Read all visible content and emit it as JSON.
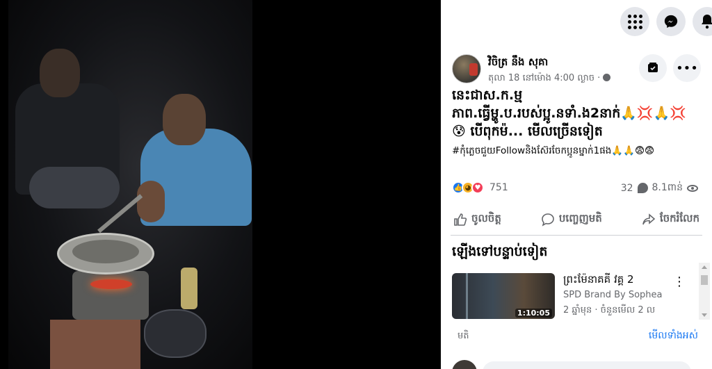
{
  "topbar": {
    "menu_icon": "grid-menu-icon",
    "messenger_icon": "messenger-icon",
    "notifications_icon": "bell-icon"
  },
  "post": {
    "author": "វិចិត្រ នឹង សុគា",
    "meta": "តុលា 18 នៅម៉ោង 4:00 ល្ងាច · ",
    "privacy_icon": "globe-icon",
    "caption": "នេះជាស.ក.ម្មភាព.ធ្វើម្ហូ.ប.របស់ប្អូ.នទាំ.ង2នាក់🙏💢🙏💢😰 បើពុកម៉... ",
    "see_more": "មើលច្រើនទៀត",
    "hashtag": "#កុំភ្លេចជួយFollowនិងស៊ែរចែកប្អូនម្នាក់1ផង🙏🙏😨😨",
    "reactions": {
      "types": [
        "like",
        "sad",
        "love"
      ],
      "count": "751"
    },
    "comments": "32",
    "views": "8.1ពាន់"
  },
  "actions": {
    "like": "ចូលចិត្ត",
    "comment": "បញ្ចេញមតិ",
    "share": "ចែករំលែក"
  },
  "up_next": {
    "heading": "ឡើងទៅបន្ទាប់ទៀត",
    "items": [
      {
        "title": "ព្រះម៉ែនាគគី វគ្គ 2",
        "channel": "SPD Brand By Sophea",
        "meta": "2 ឆ្នាំមុន · ចំនួនមើល 2 ល",
        "duration": "1:10:05"
      }
    ]
  },
  "bottom": {
    "label": "មតិ",
    "see_all": "មើលទាំងអស់"
  },
  "colors": {
    "accent": "#1877f2",
    "secondary_text": "#65676b",
    "button_bg": "#e4e6eb"
  }
}
